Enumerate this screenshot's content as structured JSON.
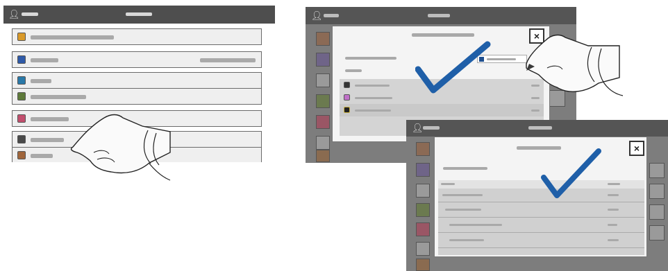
{
  "panel1": {
    "user_icon": "person-icon",
    "rows": [
      {
        "name": "row-1",
        "icon": "wrench-icon",
        "icon_color": "#d99a2a"
      },
      {
        "name": "row-2",
        "icon": "info-icon",
        "icon_color": "#2f5aa8"
      },
      {
        "name": "row-3",
        "icon": "pause-icon",
        "icon_color": "#2a79a8"
      },
      {
        "name": "row-4",
        "icon": "printer-icon",
        "icon_color": "#5e7a3a"
      },
      {
        "name": "row-5",
        "icon": "tag-icon",
        "icon_color": "#c24f6e"
      },
      {
        "name": "row-6",
        "icon": "device-icon",
        "icon_color": "#4a4a4a"
      },
      {
        "name": "row-7",
        "icon": "app-icon",
        "icon_color": "#a0663c"
      }
    ]
  },
  "panel2": {
    "user_icon": "person-icon",
    "close_label": "×",
    "checkmark_color": "#1f5fa8"
  },
  "panel3": {
    "user_icon": "person-icon",
    "close_label": "×",
    "checkmark_color": "#1f5fa8"
  }
}
